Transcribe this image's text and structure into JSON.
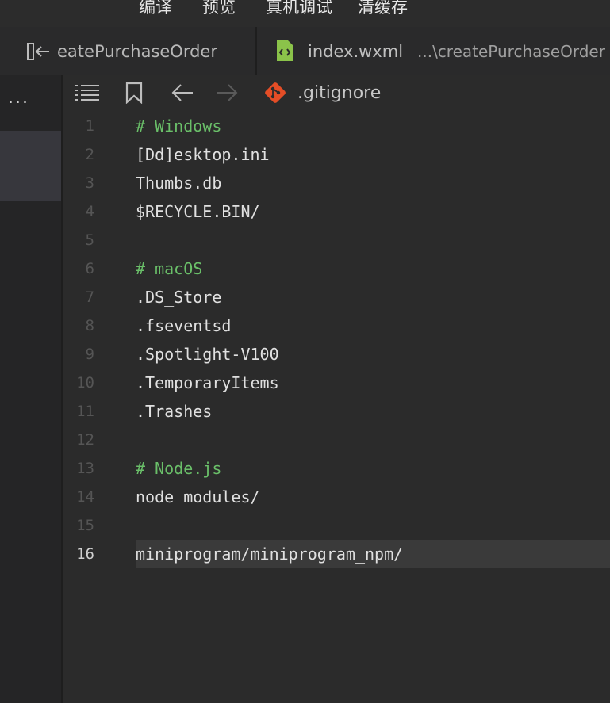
{
  "toolbar": {
    "compile_label": "编译",
    "preview_label": "预览",
    "remote_debug_label": "真机调试",
    "clear_cache_label": "清缓存"
  },
  "tabs": [
    {
      "name": "createPurchaseOrder",
      "visible_text": "eatePurchaseOrder"
    },
    {
      "name": "index.wxml",
      "path": "...\\createPurchaseOrder"
    }
  ],
  "sidebar": {
    "more_label": "..."
  },
  "breadcrumb": {
    "file_name": ".gitignore"
  },
  "colors": {
    "git_icon": "#e44d26",
    "xml_icon": "#8bc34a",
    "comment": "#6abf69"
  },
  "editor": {
    "active_line": 16,
    "lines": [
      {
        "num": "1",
        "text": "# Windows",
        "type": "comment"
      },
      {
        "num": "2",
        "text": "[Dd]esktop.ini",
        "type": "text"
      },
      {
        "num": "3",
        "text": "Thumbs.db",
        "type": "text"
      },
      {
        "num": "4",
        "text": "$RECYCLE.BIN/",
        "type": "text"
      },
      {
        "num": "5",
        "text": "",
        "type": "text"
      },
      {
        "num": "6",
        "text": "# macOS",
        "type": "comment"
      },
      {
        "num": "7",
        "text": ".DS_Store",
        "type": "text"
      },
      {
        "num": "8",
        "text": ".fseventsd",
        "type": "text"
      },
      {
        "num": "9",
        "text": ".Spotlight-V100",
        "type": "text"
      },
      {
        "num": "10",
        "text": ".TemporaryItems",
        "type": "text"
      },
      {
        "num": "11",
        "text": ".Trashes",
        "type": "text"
      },
      {
        "num": "12",
        "text": "",
        "type": "text"
      },
      {
        "num": "13",
        "text": "# Node.js",
        "type": "comment"
      },
      {
        "num": "14",
        "text": "node_modules/",
        "type": "text"
      },
      {
        "num": "15",
        "text": "",
        "type": "text"
      },
      {
        "num": "16",
        "text": "miniprogram/miniprogram_npm/",
        "type": "text"
      }
    ]
  }
}
